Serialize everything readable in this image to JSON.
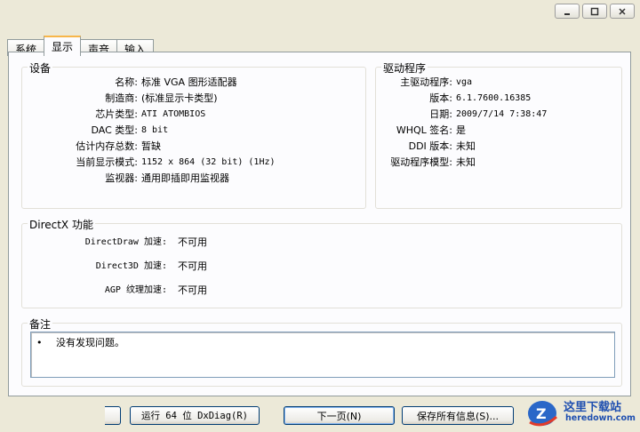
{
  "window": {
    "controls": [
      "minimize-icon",
      "maximize-icon",
      "close-icon"
    ]
  },
  "tabs": [
    {
      "label": "系统",
      "active": false
    },
    {
      "label": "显示",
      "active": true
    },
    {
      "label": "声音",
      "active": false
    },
    {
      "label": "输入",
      "active": false
    }
  ],
  "device": {
    "title": "设备",
    "rows": [
      {
        "label": "名称:",
        "value": "标准 VGA 图形适配器"
      },
      {
        "label": "制造商:",
        "value": "(标准显示卡类型)"
      },
      {
        "label": "芯片类型:",
        "value": "ATI ATOMBIOS"
      },
      {
        "label": "DAC 类型:",
        "value": "8 bit"
      },
      {
        "label": "估计内存总数:",
        "value": "暂缺"
      },
      {
        "label": "当前显示模式:",
        "value": "1152 x 864 (32 bit) (1Hz)"
      },
      {
        "label": "监视器:",
        "value": "通用即插即用监视器"
      }
    ]
  },
  "driver": {
    "title": "驱动程序",
    "rows": [
      {
        "label": "主驱动程序:",
        "value": "vga"
      },
      {
        "label": "版本:",
        "value": "6.1.7600.16385"
      },
      {
        "label": "日期:",
        "value": "2009/7/14 7:38:47"
      },
      {
        "label": "WHQL 签名:",
        "value": "是"
      },
      {
        "label": "DDI 版本:",
        "value": "未知"
      },
      {
        "label": "驱动程序模型:",
        "value": "未知"
      }
    ]
  },
  "directx": {
    "title": "DirectX 功能",
    "rows": [
      {
        "label": "DirectDraw 加速:",
        "value": "不可用"
      },
      {
        "label": "Direct3D 加速:",
        "value": "不可用"
      },
      {
        "label": "AGP 纹理加速:",
        "value": "不可用"
      }
    ]
  },
  "notes": {
    "title": "备注",
    "bullet": "•",
    "text": "没有发现问题。"
  },
  "buttons": {
    "run64": "运行 64 位 DxDiag(R)",
    "next": "下一页(N)",
    "save": "保存所有信息(S)..."
  },
  "watermark": {
    "text_cn": "这里下载站",
    "text_en": "heredown.com"
  }
}
